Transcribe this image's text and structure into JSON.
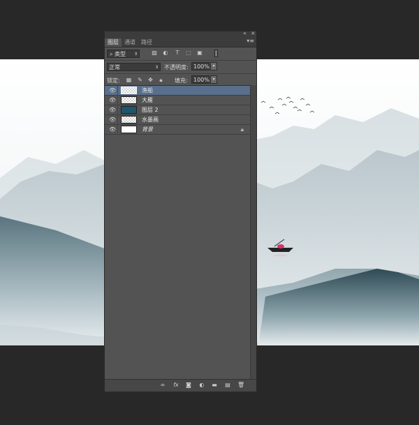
{
  "panel": {
    "collapse_icon": "collapse-arrows-icon",
    "close_icon": "close-icon",
    "tabs": [
      {
        "label": "图层",
        "active": true
      },
      {
        "label": "通道",
        "active": false
      },
      {
        "label": "路径",
        "active": false
      }
    ],
    "filter": {
      "label": "类型"
    },
    "blend_mode": "正常",
    "opacity": {
      "label": "不透明度:",
      "value": "100%"
    },
    "lock": {
      "label": "锁定:"
    },
    "fill": {
      "label": "填充:",
      "value": "100%"
    },
    "layers": [
      {
        "name": "渔船",
        "thumb": "checker",
        "selected": true,
        "locked": false
      },
      {
        "name": "大雁",
        "thumb": "checker",
        "selected": false,
        "locked": false
      },
      {
        "name": "图层 2",
        "thumb": "fill",
        "selected": false,
        "locked": false
      },
      {
        "name": "水墨画",
        "thumb": "checker",
        "selected": false,
        "locked": false
      },
      {
        "name": "背景",
        "thumb": "white",
        "selected": false,
        "locked": true
      }
    ]
  },
  "colors": {
    "selected_layer": "#596f8c",
    "panel_bg": "#535353",
    "layer2_fill": "#1f566f",
    "boat_canopy": "#e0306a"
  }
}
